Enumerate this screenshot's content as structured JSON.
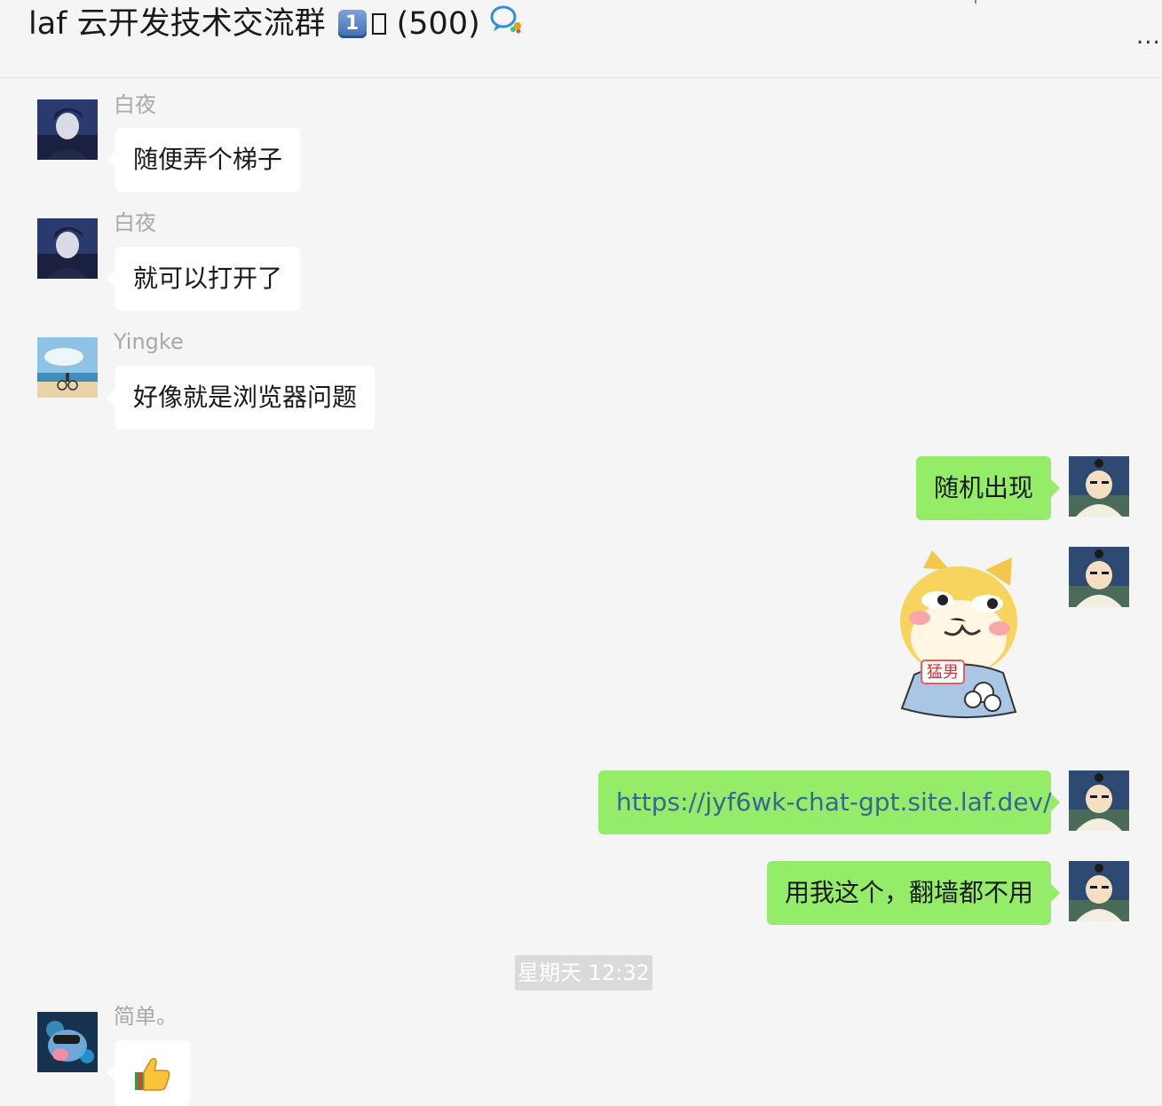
{
  "header": {
    "title": "laf 云开发技术交流群",
    "keycap_label": "1",
    "member_count": "(500)",
    "more_label": "..."
  },
  "messages": [
    {
      "sender": "白夜",
      "text": "随便弄个梯子"
    },
    {
      "sender": "白夜",
      "text": "就可以打开了"
    },
    {
      "sender": "Yingke",
      "text": "好像就是浏览器问题"
    },
    {
      "sender": "",
      "text": "随机出现"
    },
    {
      "sender": "",
      "sticker": "shiba-sticker",
      "sticker_text": "猛男"
    },
    {
      "sender": "",
      "text": "https://jyf6wk-chat-gpt.site.laf.dev/"
    },
    {
      "sender": "",
      "text": "用我这个，翻墙都不用"
    },
    {
      "sender": "简单。",
      "emoji": "👍"
    }
  ],
  "timestamp": "星期天 12:32",
  "colors": {
    "background": "#f5f5f5",
    "self_bubble": "#95ec69",
    "other_bubble": "#ffffff",
    "sender_name": "#a8a8a8",
    "link": "#386596",
    "timestamp_bg": "#dadada"
  },
  "icons": [
    "keycap-one-icon",
    "chat-bubble-icon",
    "more-options-icon",
    "thumbs-up-icon"
  ]
}
